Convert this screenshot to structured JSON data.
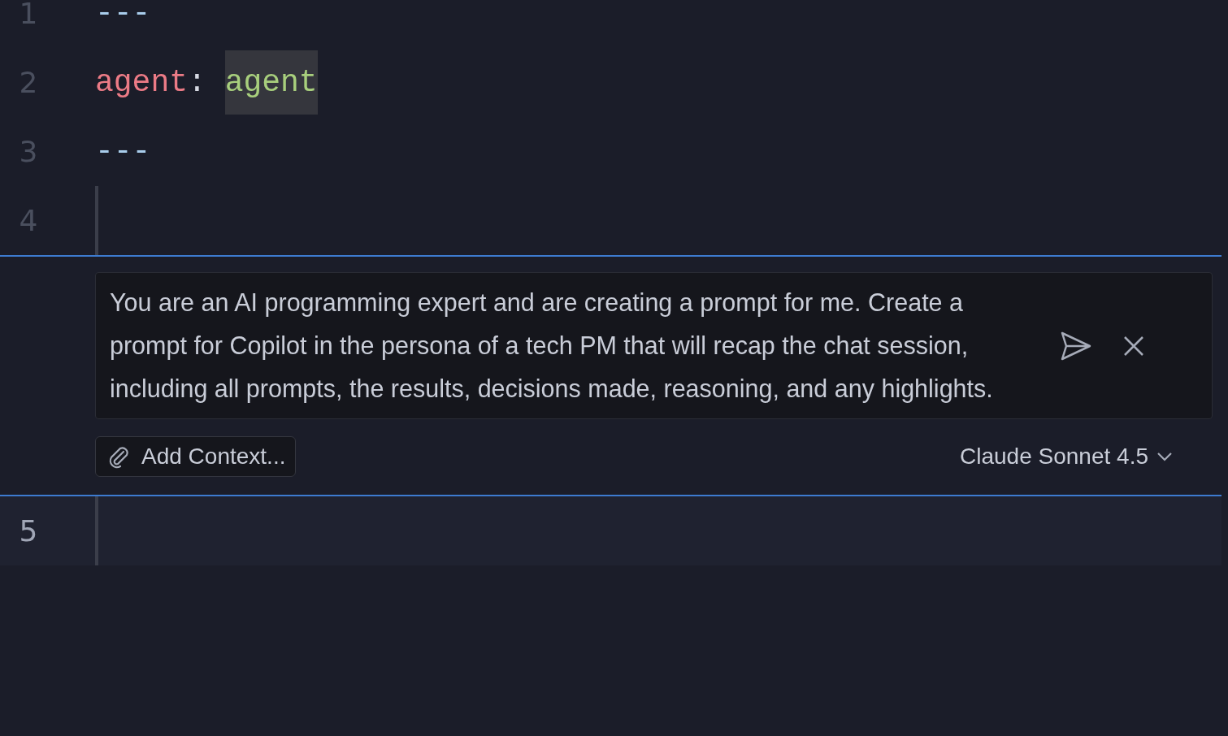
{
  "lines_above": [
    {
      "number": "1",
      "active": false,
      "tokens": [
        {
          "kind": "dash",
          "text": "---",
          "highlighted": false
        }
      ]
    },
    {
      "number": "2",
      "active": false,
      "tokens": [
        {
          "kind": "key",
          "text": "agent",
          "highlighted": false
        },
        {
          "kind": "colon",
          "text": ": ",
          "highlighted": false
        },
        {
          "kind": "value",
          "text": "agent",
          "highlighted": true
        }
      ]
    },
    {
      "number": "3",
      "active": false,
      "tokens": [
        {
          "kind": "dash",
          "text": "---",
          "highlighted": false
        }
      ]
    },
    {
      "number": "4",
      "active": false
    }
  ],
  "inline_chat": {
    "prompt": "You are an AI programming expert and are creating a prompt for me. Create a prompt for Copilot in the persona of a tech PM that will recap the chat session, including all prompts, the results, decisions made, reasoning, and any highlights.",
    "add_context": "Add Context...",
    "model": "Claude Sonnet 4.5"
  },
  "lines_below": [
    {
      "number": "5",
      "active": true
    }
  ]
}
